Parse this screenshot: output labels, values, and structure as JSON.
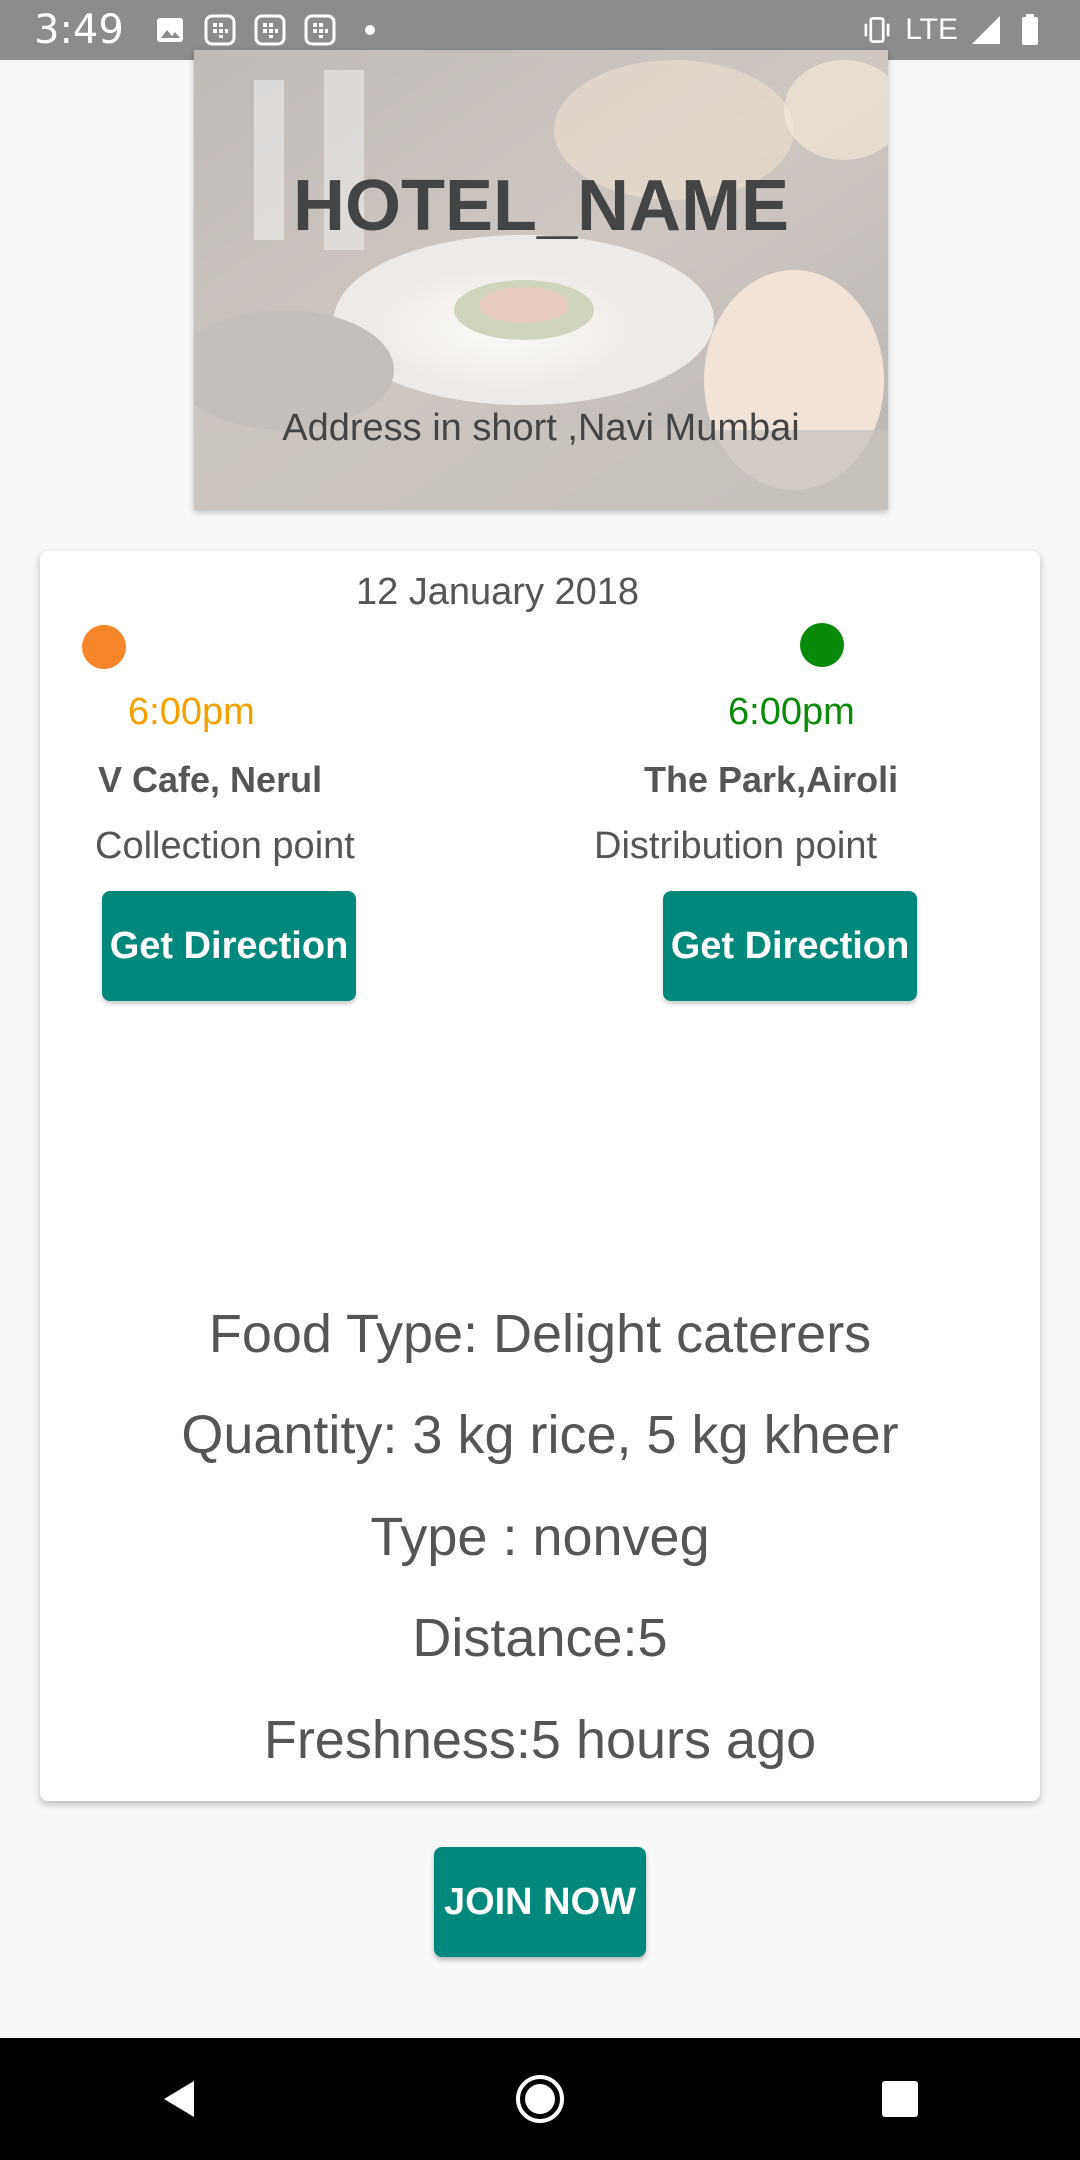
{
  "status_bar": {
    "time": "3:49",
    "network": "LTE",
    "left_icons": [
      "image-icon",
      "sim-card-icon",
      "sim-card-icon",
      "sim-card-icon",
      "dot-icon"
    ],
    "right_icons": [
      "vibrate-icon",
      "signal-icon",
      "battery-icon"
    ]
  },
  "hero": {
    "hotel_name": "HOTEL_NAME",
    "address": "Address in short ,Navi Mumbai"
  },
  "card": {
    "date": "12 January 2018",
    "collection": {
      "time": "6:00pm",
      "place": "V Cafe, Nerul",
      "label": "Collection point",
      "button": "Get Direction",
      "dot_color": "#f7852a"
    },
    "distribution": {
      "time": "6:00pm",
      "place": "The Park,Airoli",
      "label": "Distribution point",
      "button": "Get Direction",
      "dot_color": "#0a8a0a"
    },
    "food_type": "Food Type: Delight caterers",
    "quantity": "Quantity: 3 kg rice, 5 kg kheer",
    "type": "Type : nonveg",
    "distance": "Distance:5",
    "freshness": "Freshness:5 hours ago"
  },
  "join_button": "JOIN NOW",
  "colors": {
    "accent": "#00897b",
    "collection_time": "#f4a100",
    "distribution_time": "#0a8a0a"
  },
  "nav": {
    "icons": [
      "back-icon",
      "home-icon",
      "recents-icon"
    ]
  }
}
